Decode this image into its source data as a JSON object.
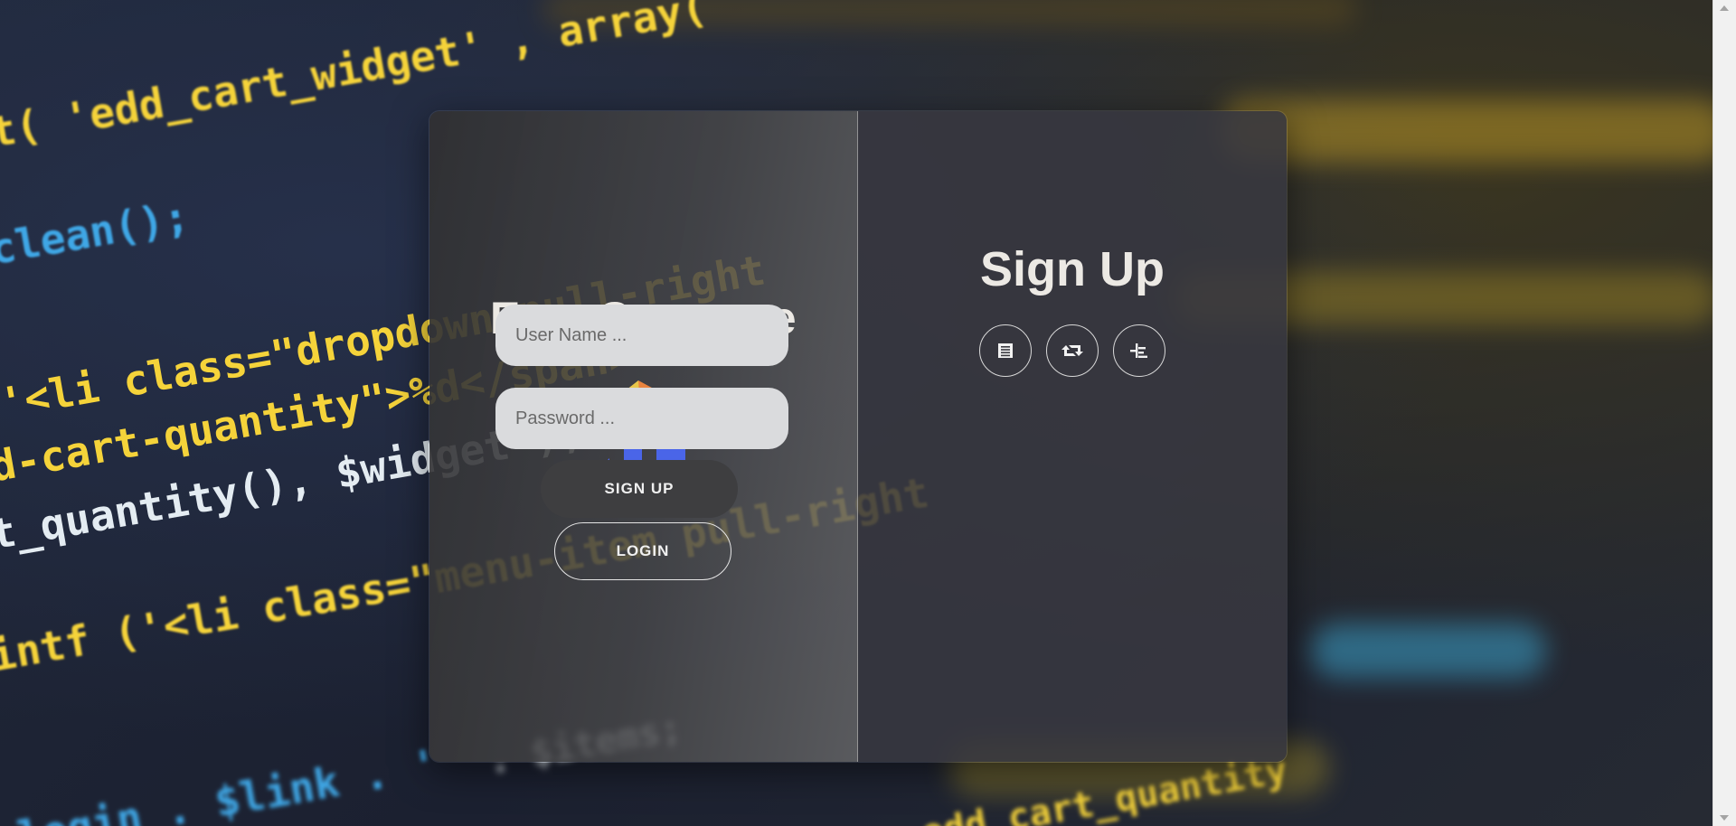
{
  "background": {
    "code_lines": [
      "t( 'edd_cart_widget' , array(",
      "clean();",
      "'<li class=\"dropdown pull-right",
      "d-cart-quantity\">%d</span>",
      "t_quantity(), $widget );",
      "intf ('<li class=\"menu-item pull-right",
      ". $items;",
      "login . $link . '",
      "edd_cart_quantity"
    ]
  },
  "left_panel": {
    "brand_title": "EasyCompare",
    "logo_icon": "easycompare-logo-icon",
    "login_label": "LOGIN"
  },
  "right_panel": {
    "title": "Sign Up",
    "social_buttons": [
      {
        "icon": "list-icon"
      },
      {
        "icon": "retweet-icon"
      },
      {
        "icon": "structure-icon"
      }
    ],
    "username_placeholder": "User Name ...",
    "password_placeholder": "Password ...",
    "signup_label": "SIGN UP"
  },
  "colors": {
    "brand_blue": "#4a65e8",
    "brand_orange": "#e9843f",
    "brand_yellow": "#e8c64a",
    "input_bg": "#dadbdd",
    "button_dark": "#3e3e40"
  }
}
